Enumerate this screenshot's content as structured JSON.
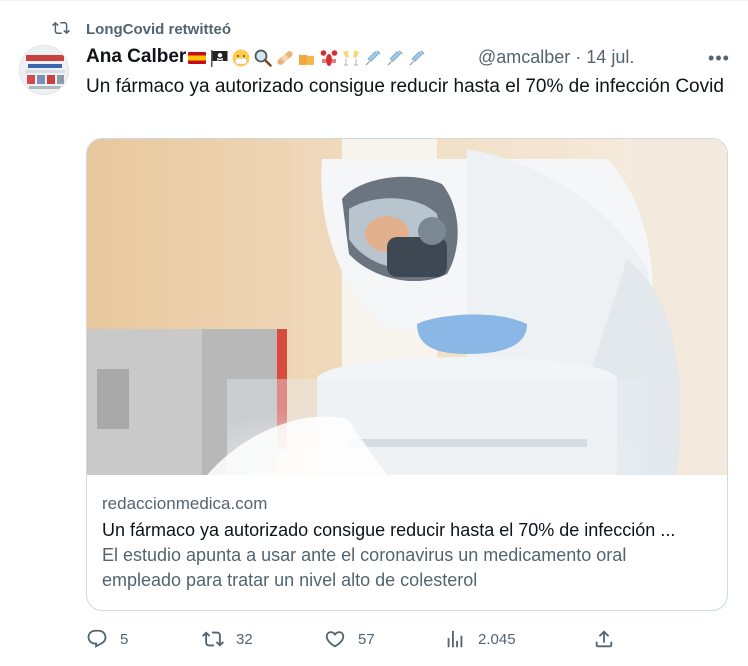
{
  "retweet": {
    "icon": "retweet-icon",
    "label": "LongCovid retwitteó"
  },
  "author": {
    "name": "Ana Calber",
    "handle_date": "@amcalber · 14 jul.",
    "emojis": [
      "spain-flag-icon",
      "pirate-flag-icon",
      "mask-face-icon",
      "magnifier-icon",
      "bandage-icon",
      "beer-mugs-icon",
      "lobster-icon",
      "clinking-glasses-icon",
      "syringe-icon",
      "syringe-icon",
      "syringe-icon"
    ],
    "more_label": "•••"
  },
  "tweet": {
    "text": "Un fármaco ya autorizado consigue reducir hasta el 70% de infección Covid"
  },
  "card": {
    "domain": "redaccionmedica.com",
    "title": "Un fármaco ya autorizado consigue reducir hasta el 70% de infección ...",
    "description": "El estudio apunta a usar ante el coronavirus un medicamento oral empleado para tratar un nivel alto de colesterol"
  },
  "actions": {
    "replies": "5",
    "retweets": "32",
    "likes": "57",
    "views": "2.045"
  },
  "colors": {
    "text": "#0f1419",
    "secondary": "#536471",
    "border": "#cfd9de"
  }
}
